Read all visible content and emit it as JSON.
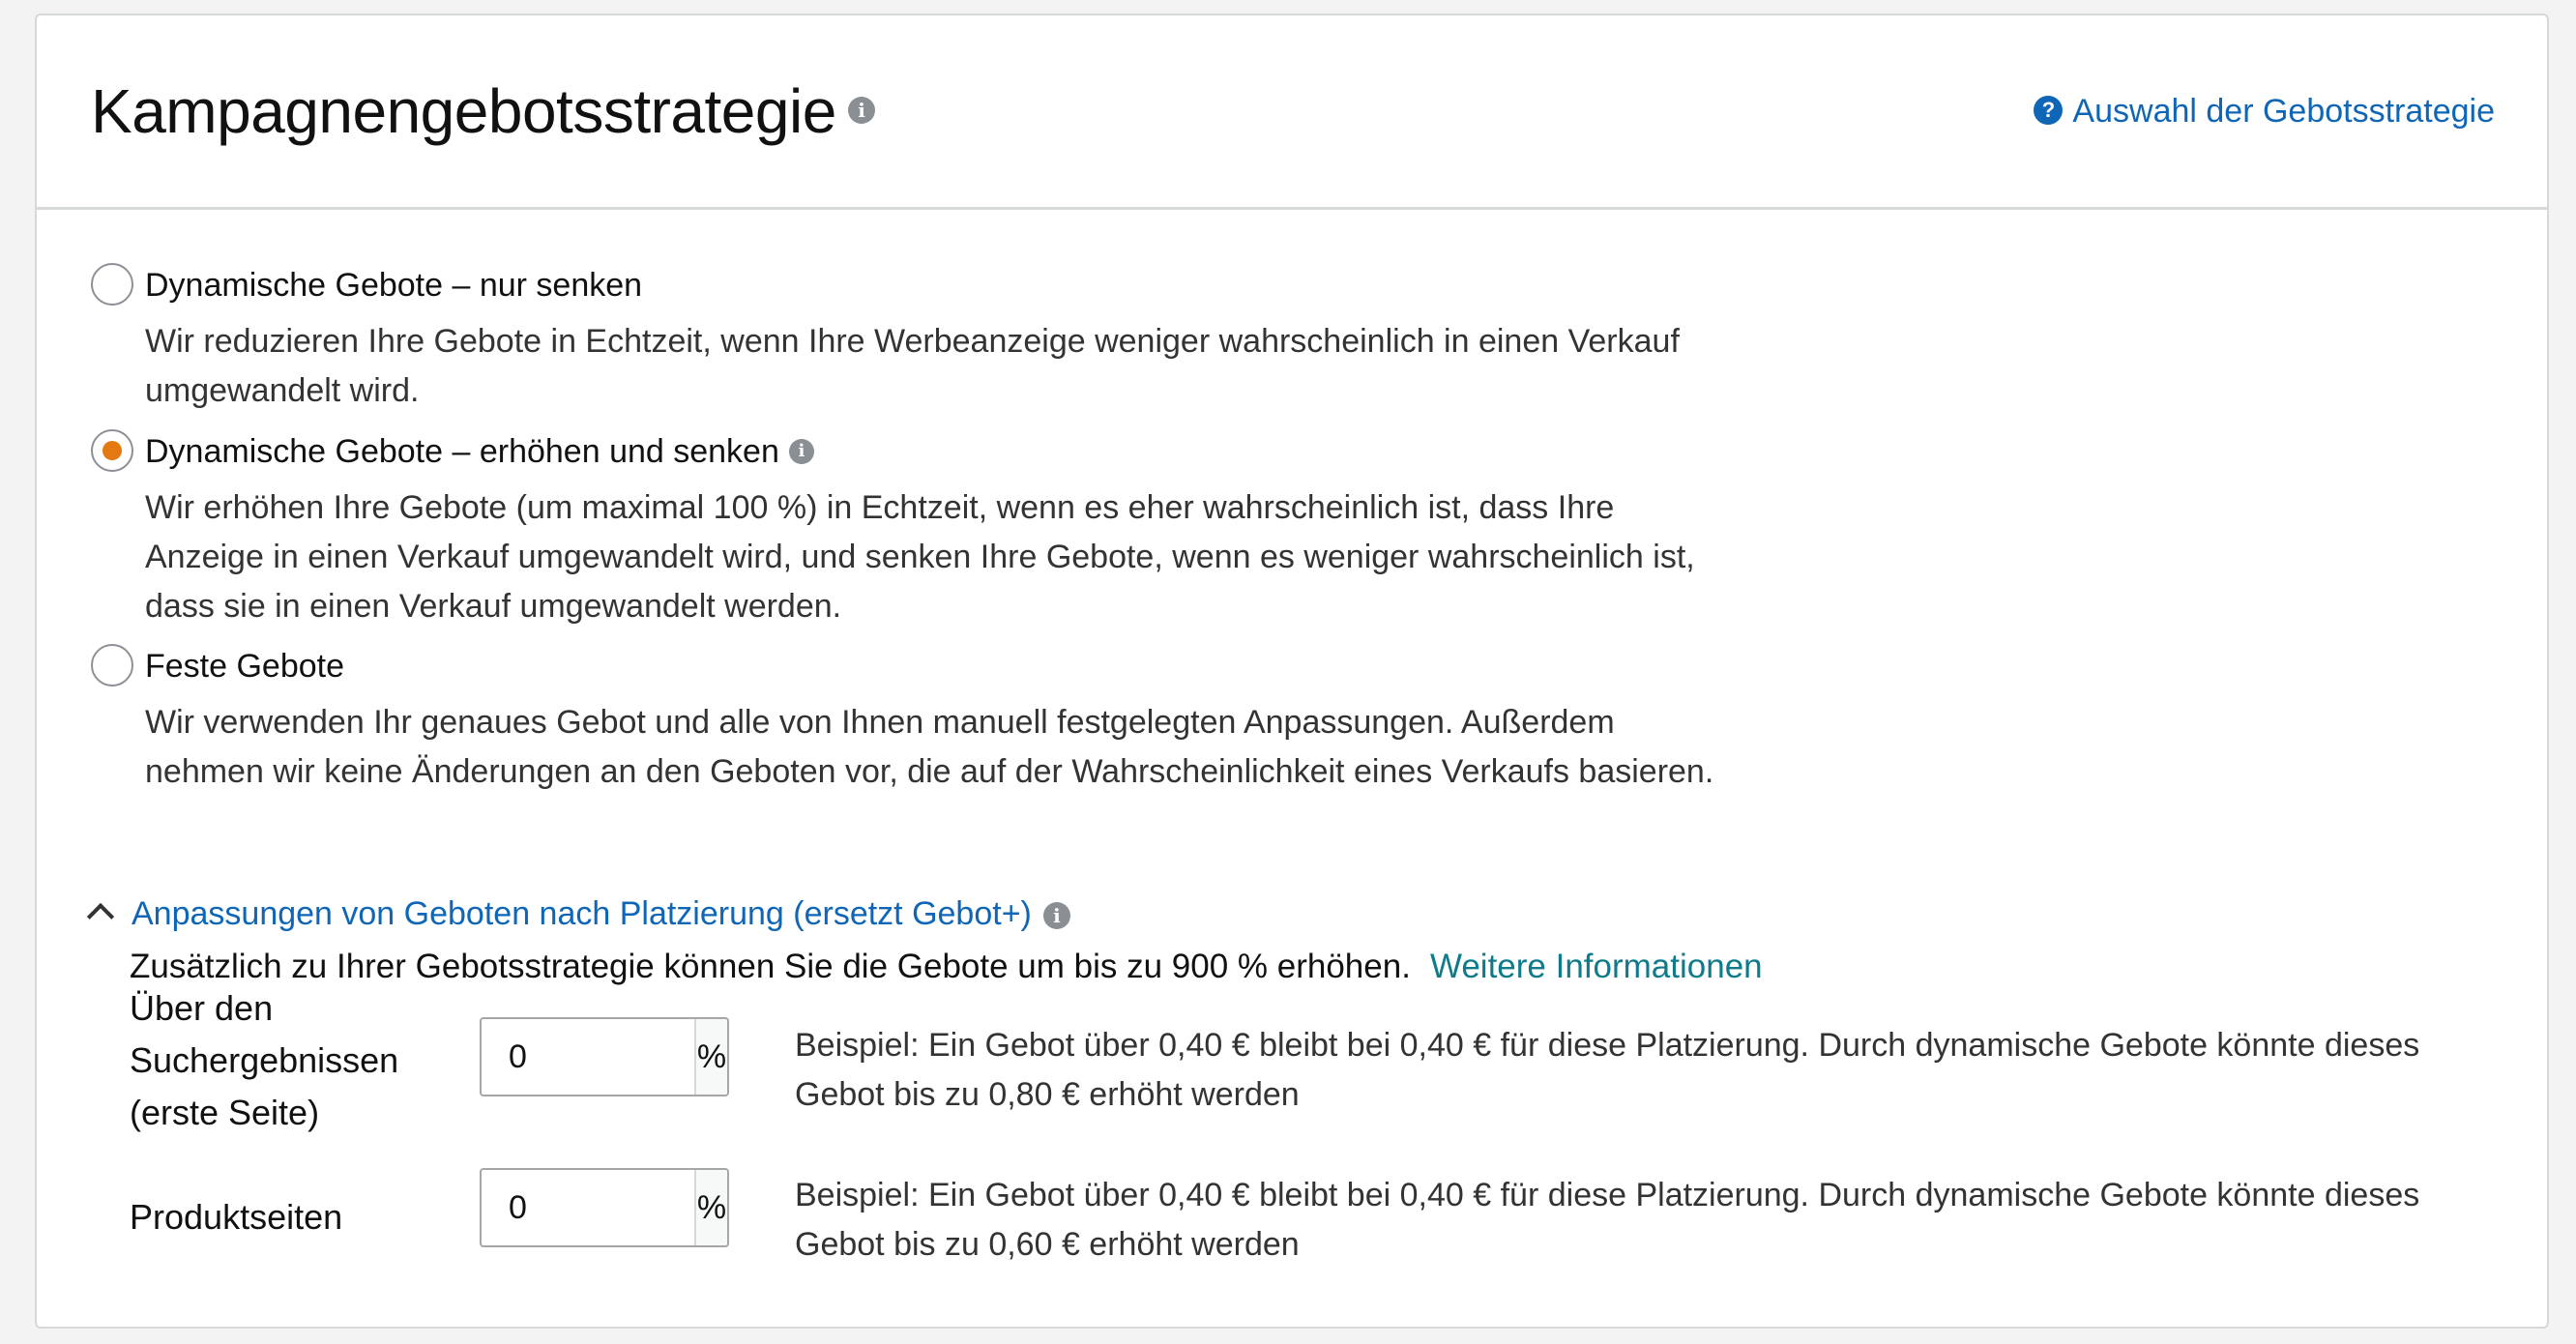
{
  "header": {
    "title": "Kampagnengebotsstrategie",
    "help_link": "Auswahl der Gebotsstrategie"
  },
  "strategies": [
    {
      "label": "Dynamische Gebote – nur senken",
      "description": "Wir reduzieren Ihre Gebote in Echtzeit, wenn Ihre Werbeanzeige weniger wahrscheinlich in einen Verkauf umgewandelt wird.",
      "selected": false
    },
    {
      "label": "Dynamische Gebote – erhöhen und senken",
      "description": "Wir erhöhen Ihre Gebote (um maximal 100 %) in Echtzeit, wenn es eher wahrscheinlich ist, dass Ihre Anzeige in einen Verkauf umgewandelt wird, und senken Ihre Gebote, wenn es weniger wahrscheinlich ist, dass sie in einen Verkauf umgewandelt werden.",
      "selected": true
    },
    {
      "label": "Feste Gebote",
      "description": "Wir verwenden Ihr genaues Gebot und alle von Ihnen manuell festgelegten Anpassungen. Außerdem nehmen wir keine Änderungen an den Geboten vor, die auf der Wahrscheinlichkeit eines Verkaufs basieren.",
      "selected": false
    }
  ],
  "placement": {
    "toggle_label": "Anpassungen von Geboten nach Platzierung (ersetzt Gebot+)",
    "intro": "Zusätzlich zu Ihrer Gebotsstrategie können Sie die Gebote um bis zu 900 % erhöhen.",
    "more_link": "Weitere Informationen",
    "rows": [
      {
        "label": "Über den Suchergebnissen (erste Seite)",
        "value": "0",
        "unit": "%",
        "example": "Beispiel: Ein Gebot über 0,40 € bleibt bei 0,40 € für diese Platzierung. Durch dynamische Gebote könnte dieses Gebot bis zu 0,80 € erhöht werden"
      },
      {
        "label": "Produktseiten",
        "value": "0",
        "unit": "%",
        "example": "Beispiel: Ein Gebot über 0,40 € bleibt bei 0,40 € für diese Platzierung. Durch dynamische Gebote könnte dieses Gebot bis zu 0,60 € erhöht werden"
      }
    ]
  },
  "colors": {
    "link": "#0f66b7",
    "more_link": "#0f7b8a",
    "radio_selected": "#e47911",
    "info_icon": "#8a8f94"
  },
  "icons": {
    "title_info": "info-icon",
    "help": "question-circle-icon",
    "toggle": "chevron-up-icon"
  }
}
